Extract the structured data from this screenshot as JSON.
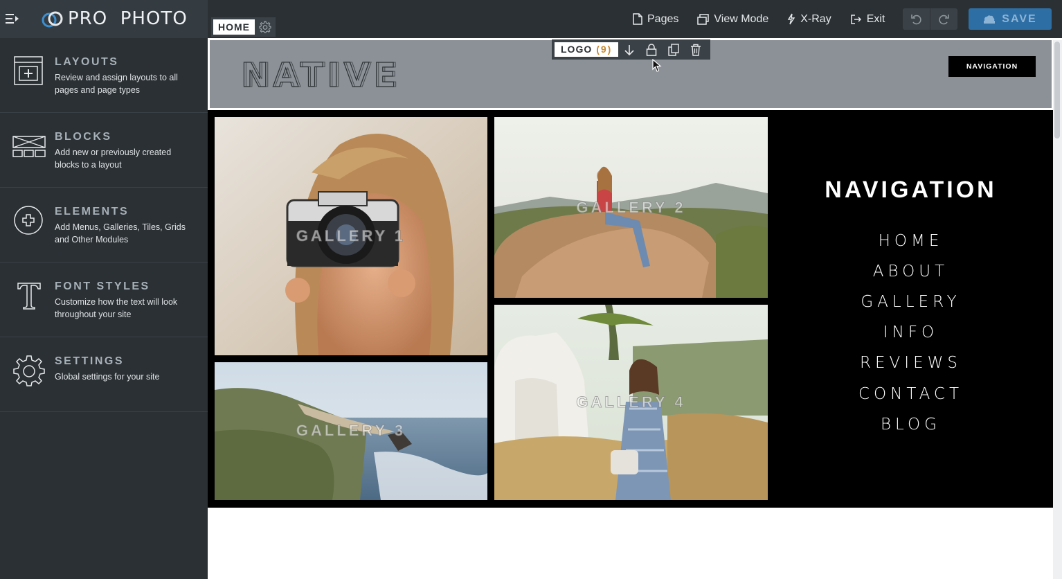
{
  "app": {
    "brand_name": "PRO  PHOTO"
  },
  "toolbar": {
    "pages_label": "Pages",
    "view_mode_label": "View Mode",
    "xray_label": "X-Ray",
    "exit_label": "Exit",
    "save_label": "SAVE"
  },
  "sidebar": {
    "items": [
      {
        "title": "LAYOUTS",
        "desc": "Review and assign layouts to all pages and page types",
        "icon": "layout-icon"
      },
      {
        "title": "BLOCKS",
        "desc": "Add new or previously created blocks to a layout",
        "icon": "blocks-icon"
      },
      {
        "title": "ELEMENTS",
        "desc": "Add Menus, Galleries, Tiles, Grids and Other Modules",
        "icon": "add-element-icon"
      },
      {
        "title": "FONT STYLES",
        "desc": "Customize how the text will look throughout your site",
        "icon": "font-icon"
      },
      {
        "title": "SETTINGS",
        "desc": "Global settings for your site",
        "icon": "gear-icon"
      }
    ]
  },
  "page_tag": {
    "label": "HOME"
  },
  "logo_toolbar": {
    "label": "LOGO",
    "count": "(9)"
  },
  "site": {
    "logo_text": "NATIVE",
    "nav_button": "NAVIGATION",
    "nav_title": "NAVIGATION",
    "nav_links": [
      "HOME",
      "ABOUT",
      "GALLERY",
      "INFO",
      "REVIEWS",
      "CONTACT",
      "BLOG"
    ],
    "galleries": [
      "GALLERY 1",
      "GALLERY 2",
      "GALLERY 3",
      "GALLERY 4"
    ]
  },
  "colors": {
    "sidebar_bg": "#2b3034",
    "save_button": "#2d6ea5",
    "header_band": "#8b9197",
    "logo_count": "#c9882e"
  }
}
